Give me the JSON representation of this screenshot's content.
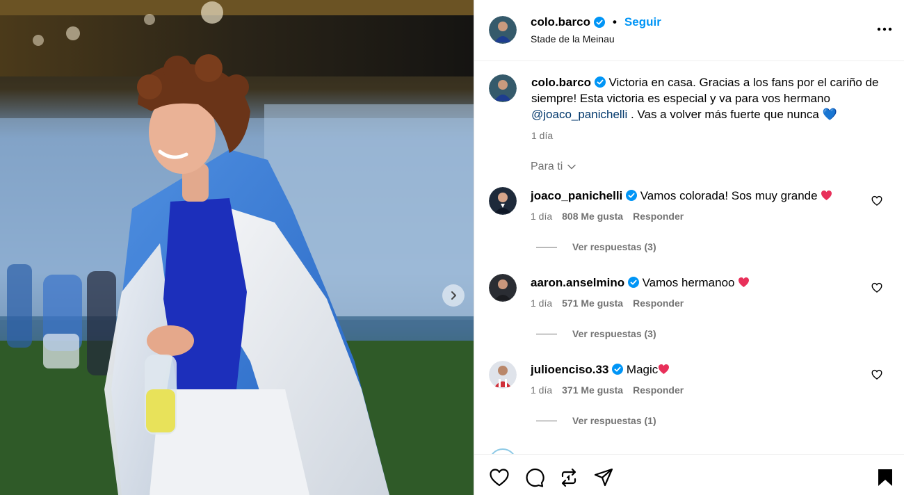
{
  "post": {
    "username": "colo.barco",
    "follow_label": "Seguir",
    "separator": "•",
    "location": "Stade de la Meinau"
  },
  "caption": {
    "username": "colo.barco",
    "text_before": "Victoria en casa. Gracias a los fans por el cariño de siempre! Esta victoria es especial y va para vos hermano",
    "mention": "@joaco_panichelli",
    "text_after": ". Vas a volver más fuerte que nunca",
    "emoji": "💙",
    "time": "1 día"
  },
  "comments_filter": {
    "label": "Para ti"
  },
  "comments": [
    {
      "username": "joaco_panichelli",
      "text": "Vamos colorada! Sos muy grande",
      "time": "1 día",
      "likes": "808 Me gusta",
      "reply_label": "Responder",
      "view_replies": "Ver respuestas (3)"
    },
    {
      "username": "aaron.anselmino",
      "text": "Vamos hermanoo",
      "time": "1 día",
      "likes": "571 Me gusta",
      "reply_label": "Responder",
      "view_replies": "Ver respuestas (3)"
    },
    {
      "username": "julioenciso.33",
      "text": "Magic",
      "time": "1 día",
      "likes": "371 Me gusta",
      "reply_label": "Responder",
      "view_replies": "Ver respuestas (1)"
    }
  ],
  "icons": {
    "verified": "verified-badge-icon",
    "more": "more-options-icon",
    "like": "heart-icon",
    "comment": "comment-icon",
    "repost": "repost-icon",
    "share": "share-icon",
    "save": "bookmark-icon",
    "next": "chevron-right-icon"
  },
  "colors": {
    "accent": "#0095f6",
    "mention": "#00376b",
    "muted": "#737373",
    "verified": "#0095f6",
    "heart_emoji": "#e8305a",
    "blue_heart_emoji": "#3b82f6"
  }
}
